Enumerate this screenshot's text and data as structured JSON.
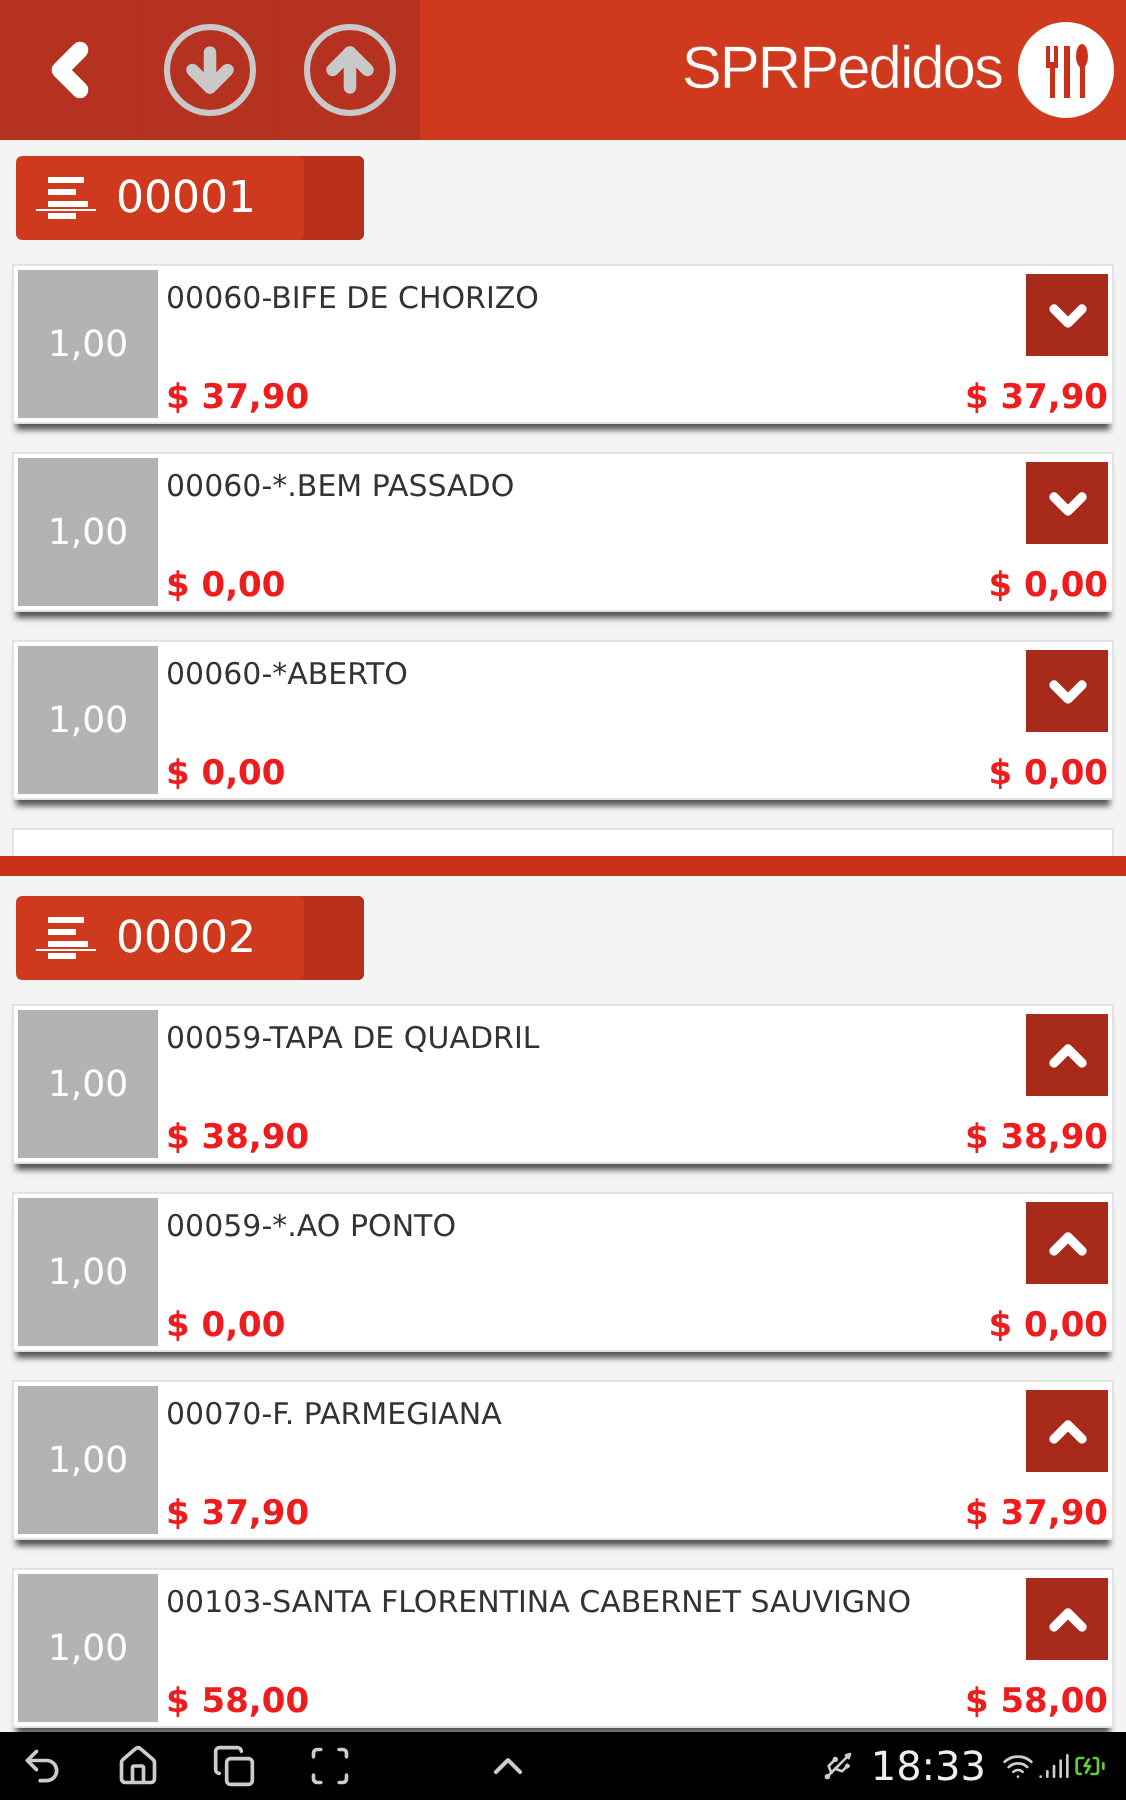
{
  "app_bar": {
    "brand": "SPRPedidos"
  },
  "groups": [
    {
      "number": "00001",
      "expanded": false,
      "items": [
        {
          "qty": "1,00",
          "name": "00060-BIFE DE CHORIZO",
          "unit_price": "$ 37,90",
          "total": "$ 37,90"
        },
        {
          "qty": "1,00",
          "name": "00060-*.BEM PASSADO",
          "unit_price": "$ 0,00",
          "total": "$ 0,00"
        },
        {
          "qty": "1,00",
          "name": "00060-*ABERTO",
          "unit_price": "$ 0,00",
          "total": "$ 0,00"
        }
      ]
    },
    {
      "number": "00002",
      "expanded": true,
      "items": [
        {
          "qty": "1,00",
          "name": "00059-TAPA DE QUADRIL",
          "unit_price": "$ 38,90",
          "total": "$ 38,90"
        },
        {
          "qty": "1,00",
          "name": "00059-*.AO PONTO",
          "unit_price": "$ 0,00",
          "total": "$ 0,00"
        },
        {
          "qty": "1,00",
          "name": "00070-F. PARMEGIANA",
          "unit_price": "$ 37,90",
          "total": "$ 37,90"
        },
        {
          "qty": "1,00",
          "name": "00103-SANTA FLORENTINA CABERNET SAUVIGNO",
          "unit_price": "$ 58,00",
          "total": "$ 58,00"
        }
      ]
    }
  ],
  "nav_bar": {
    "time": "18:33"
  }
}
